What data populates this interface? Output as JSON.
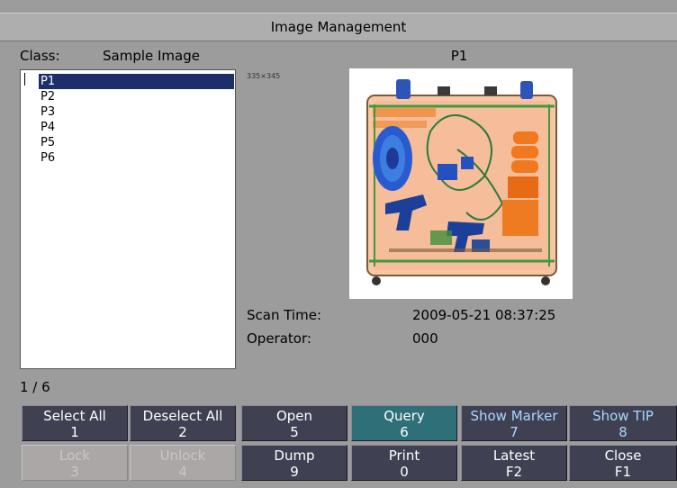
{
  "window": {
    "title": "Image Management"
  },
  "class_row": {
    "label": "Class:",
    "value": "Sample Image"
  },
  "preview": {
    "title": "P1",
    "dimensions": "335×345"
  },
  "list": {
    "items": [
      "P1",
      "P2",
      "P3",
      "P4",
      "P5",
      "P6"
    ],
    "selected": "P1"
  },
  "pagination": {
    "text": "1 / 6"
  },
  "scan": {
    "time_label": "Scan Time:",
    "time_value": "2009-05-21 08:37:25",
    "operator_label": "Operator:",
    "operator_value": "000"
  },
  "buttons_row1": [
    {
      "label": "Select All",
      "key": "1"
    },
    {
      "label": "Deselect All",
      "key": "2"
    },
    {
      "label": "Open",
      "key": "5"
    },
    {
      "label": "Query",
      "key": "6"
    },
    {
      "label": "Show Marker",
      "key": "7"
    },
    {
      "label": "Show TIP",
      "key": "8"
    }
  ],
  "buttons_row2": [
    {
      "label": "Lock",
      "key": "3"
    },
    {
      "label": "Unlock",
      "key": "4"
    },
    {
      "label": "Dump",
      "key": "9"
    },
    {
      "label": "Print",
      "key": "0"
    },
    {
      "label": "Latest",
      "key": "F2"
    },
    {
      "label": "Close",
      "key": "F1"
    }
  ],
  "colors": {
    "background": "#9c9c9c",
    "button": "#3f4153",
    "button_active": "#2f6f78",
    "button_disabled": "#aba7a7",
    "selection": "#1c2f6a"
  }
}
